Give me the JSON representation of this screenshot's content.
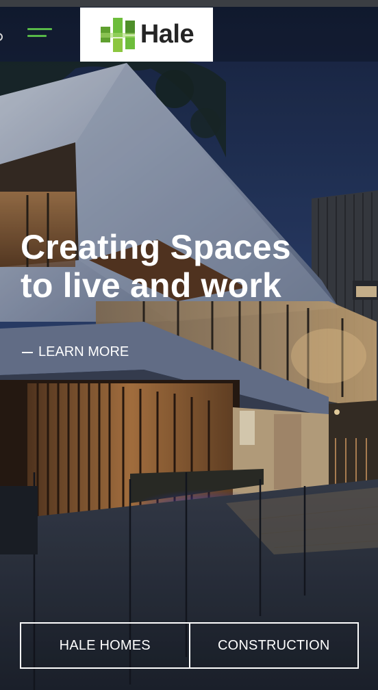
{
  "brand": {
    "name": "Hale",
    "accent_color": "#58b948",
    "logo_icon": "h-blocks-logo-icon"
  },
  "header": {
    "menu_icon": "hamburger-menu-icon"
  },
  "hero": {
    "headline_line1": "Creating Spaces",
    "headline_line2": "to live and work",
    "learn_more": "LEARN MORE"
  },
  "buttons": {
    "left": "HALE HOMES",
    "right": "CONSTRUCTION"
  }
}
